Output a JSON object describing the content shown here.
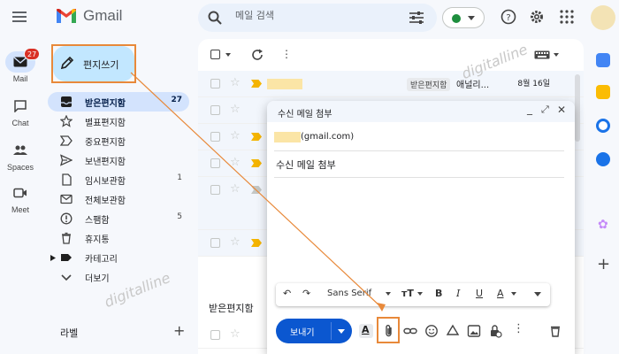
{
  "app": {
    "name": "Gmail"
  },
  "search": {
    "placeholder": "메일 검색"
  },
  "rail": {
    "items": [
      {
        "label": "Mail",
        "badge": "27",
        "active": true
      },
      {
        "label": "Chat"
      },
      {
        "label": "Spaces"
      },
      {
        "label": "Meet"
      }
    ]
  },
  "sidebar": {
    "compose_label": "편지쓰기",
    "items": [
      {
        "label": "받은편지함",
        "count": "27",
        "icon": "inbox-icon",
        "active": true
      },
      {
        "label": "별표편지함",
        "count": "",
        "icon": "star-icon"
      },
      {
        "label": "중요편지함",
        "count": "",
        "icon": "important-icon"
      },
      {
        "label": "보낸편지함",
        "count": "",
        "icon": "send-icon"
      },
      {
        "label": "임시보관함",
        "count": "1",
        "icon": "draft-icon"
      },
      {
        "label": "전체보관함",
        "count": "",
        "icon": "mail-icon"
      },
      {
        "label": "스팸함",
        "count": "5",
        "icon": "spam-icon"
      },
      {
        "label": "휴지통",
        "count": "",
        "icon": "trash-icon"
      },
      {
        "label": "카테고리",
        "count": "",
        "icon": "label-icon"
      },
      {
        "label": "더보기",
        "count": "",
        "icon": "chevron-down-icon"
      }
    ],
    "labels_heading": "라벨"
  },
  "list": {
    "rows": [
      {
        "tag": "받은편지함",
        "subject": "애널리...",
        "date": "8월 16일"
      }
    ],
    "section_heading": "받은편지함"
  },
  "compose": {
    "title": "수신 메일 첨부",
    "recipient_suffix": "(gmail.com)",
    "subject": "수신 메일 첨부",
    "font_name": "Sans Serif",
    "send_label": "보내기"
  },
  "watermark": "digitalline",
  "colors": {
    "accent": "#0b57d0",
    "highlight": "#e8893a",
    "compose_bg": "#c2e7ff",
    "active_nav": "#d3e3fd",
    "badge": "#d93025"
  }
}
